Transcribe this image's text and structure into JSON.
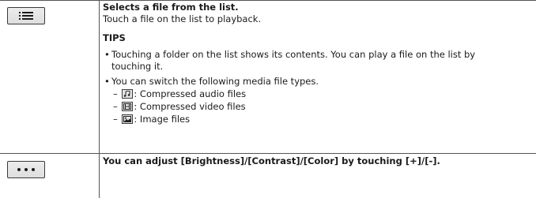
{
  "rows": [
    {
      "icon": "list-menu-icon",
      "heading": "Selects a file from the list.",
      "description": "Touch a file on the list to playback.",
      "tips_title": "TIPS",
      "tips": [
        {
          "bullet": "•",
          "line1": "Touching a folder on the list shows its contents. You can play a file on the list by",
          "line2": "touching it."
        },
        {
          "bullet": "•",
          "line1": "You can switch the following media file types."
        }
      ],
      "media_types": [
        {
          "dash": "–",
          "icon": "music-note-icon",
          "label": ": Compressed audio files"
        },
        {
          "dash": "–",
          "icon": "film-icon",
          "label": ": Compressed video files"
        },
        {
          "dash": "–",
          "icon": "image-icon",
          "label": ": Image files"
        }
      ]
    },
    {
      "icon": "more-options-icon",
      "heading": "You can adjust [Brightness]/[Contrast]/[Color] by touching [+]/[-]."
    }
  ]
}
